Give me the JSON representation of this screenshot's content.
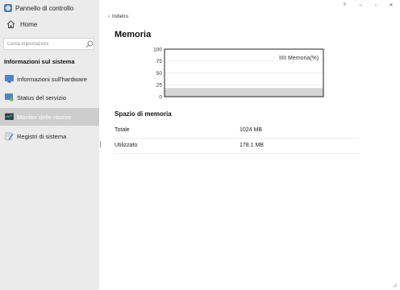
{
  "window": {
    "title": "Pannello di controllo",
    "controls": {
      "help": "?",
      "minimize": "–",
      "maximize": "▫",
      "close": "✕"
    }
  },
  "sidebar": {
    "home_label": "Home",
    "search_placeholder": "Cerca impostazioni",
    "section_title": "Informazioni sul sistema",
    "items": [
      {
        "label": "Informazioni sull'hardware",
        "icon": "monitor-icon",
        "active": false
      },
      {
        "label": "Status del servizio",
        "icon": "service-icon",
        "active": false
      },
      {
        "label": "Monitor delle risorse",
        "icon": "resource-monitor-icon",
        "active": true
      },
      {
        "label": "Registri di sistema",
        "icon": "log-icon",
        "active": false
      }
    ]
  },
  "main": {
    "back_label": "Indietro",
    "title": "Memoria",
    "memory_section_title": "Spazio di memoria",
    "rows": [
      {
        "key": "Totale",
        "value": "1024 MB"
      },
      {
        "key": "Utilizzato",
        "value": "178.1 MB"
      }
    ]
  },
  "chart_data": {
    "type": "area",
    "title": "",
    "xlabel": "",
    "ylabel": "",
    "ylim": [
      0,
      100
    ],
    "yticks": [
      0,
      25,
      50,
      75,
      100
    ],
    "legend": "Memoria(%)",
    "legend_position": "top-right",
    "grid": true,
    "series": [
      {
        "name": "Memoria(%)",
        "values": [
          17.4,
          17.4,
          17.4,
          17.4,
          17.4,
          17.4,
          17.4,
          17.4,
          17.4,
          17.4
        ],
        "color": "#d4d4d4"
      }
    ]
  }
}
